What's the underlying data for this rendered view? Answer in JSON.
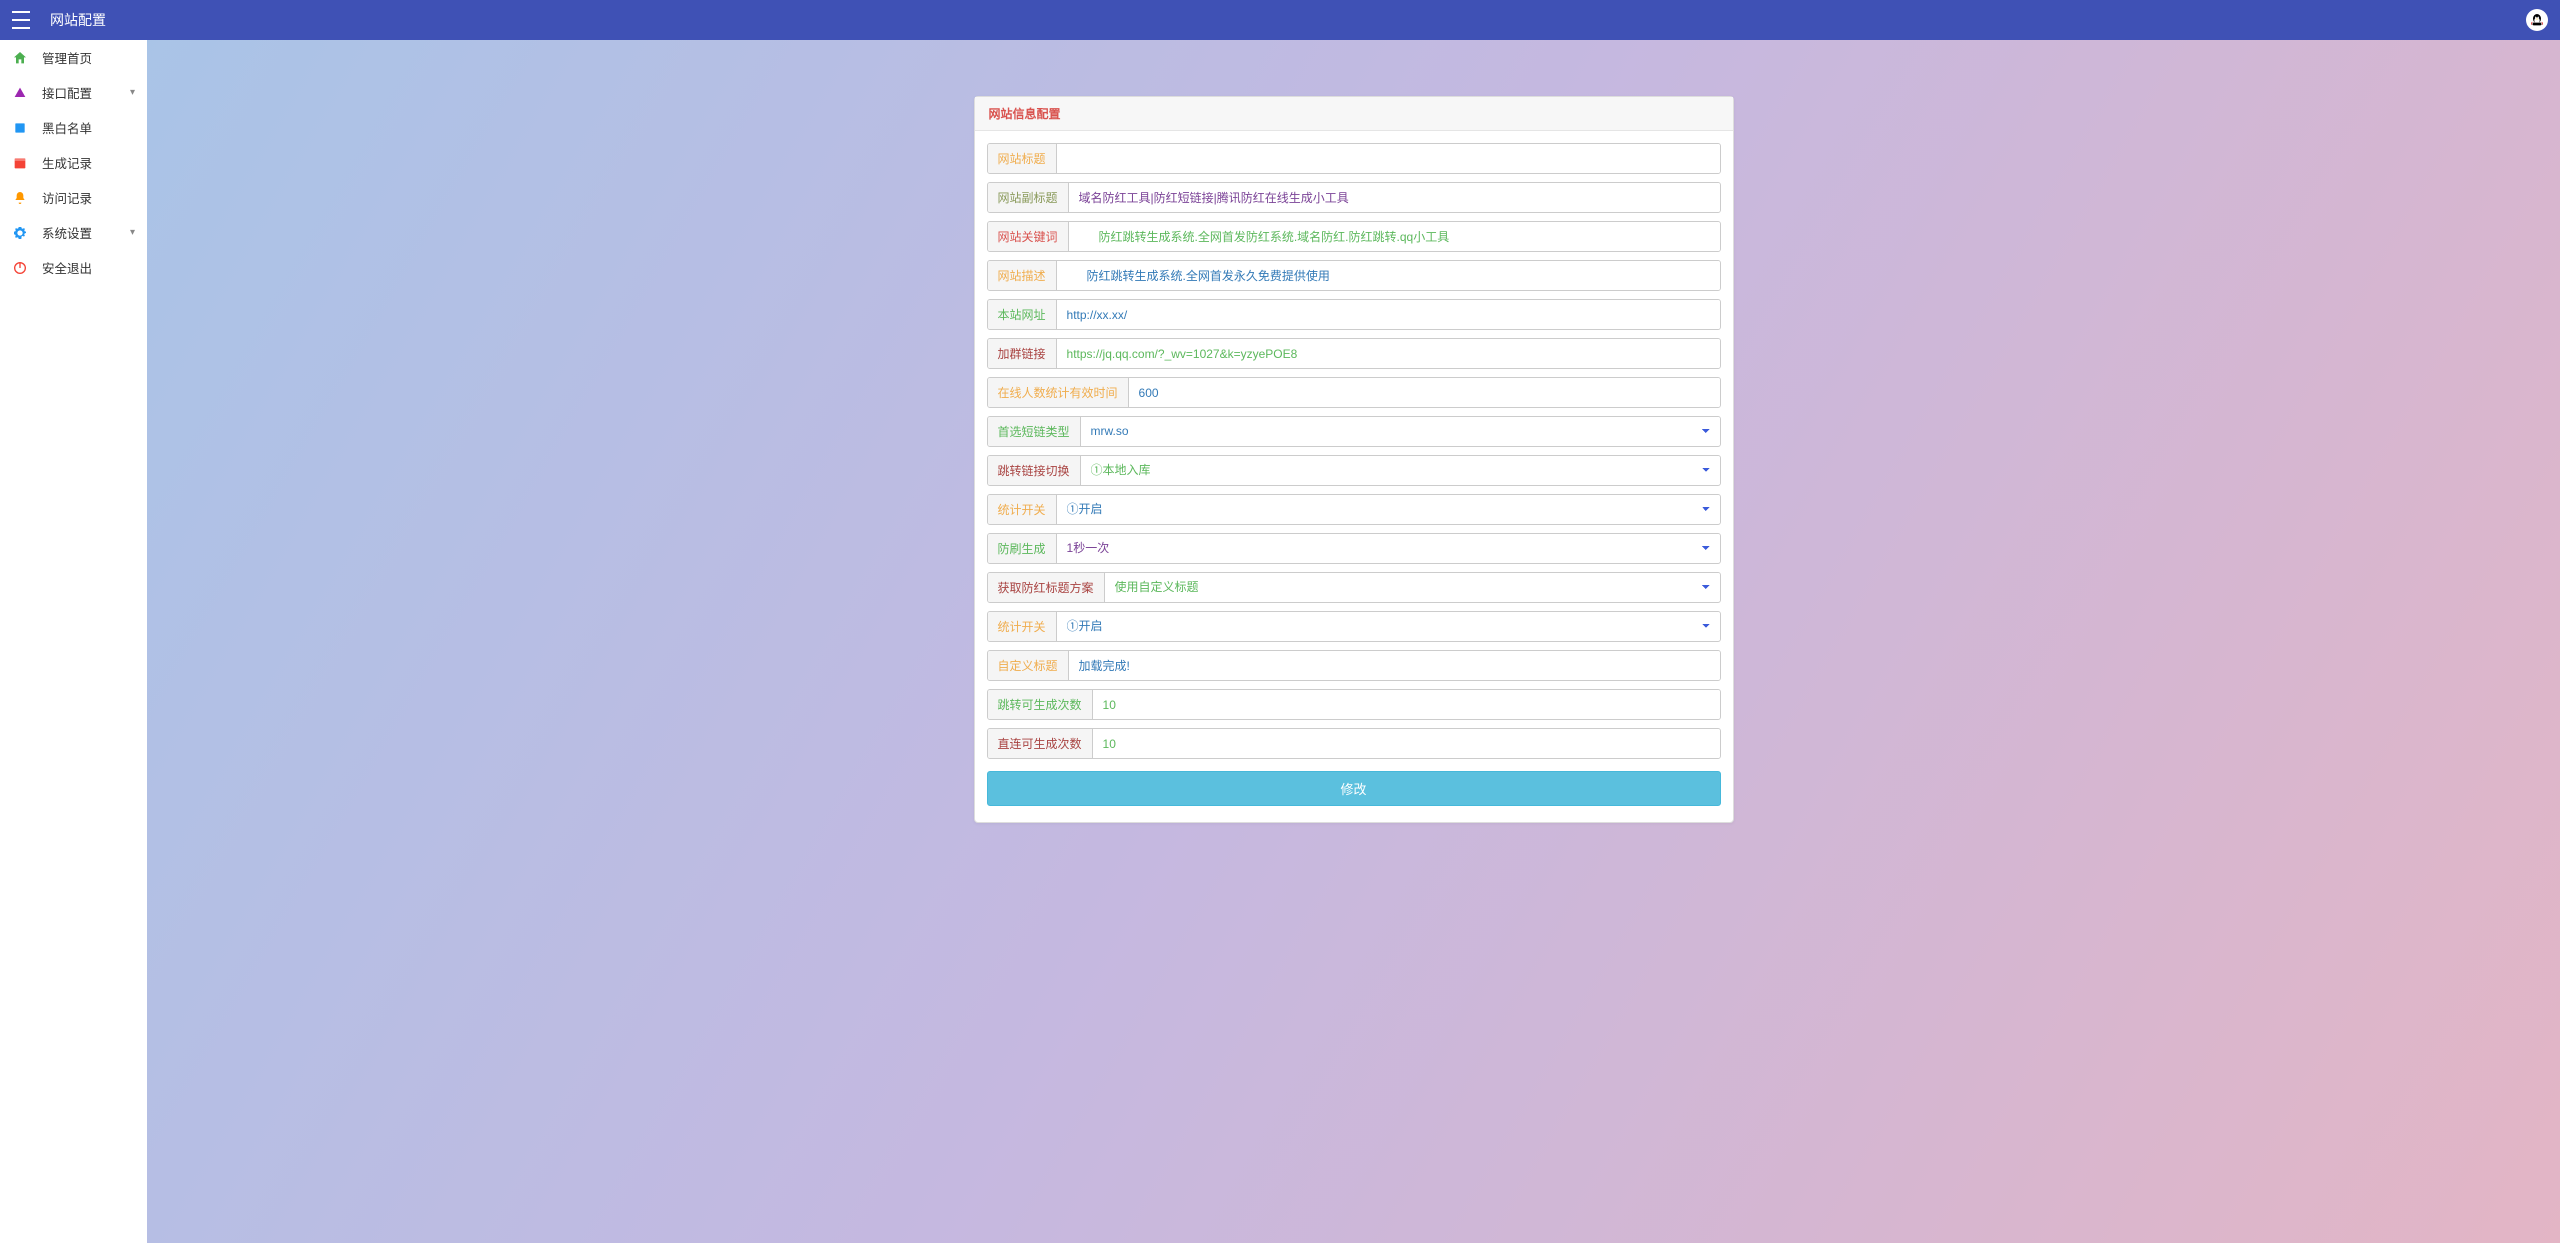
{
  "header": {
    "title": "网站配置"
  },
  "sidebar": {
    "items": [
      {
        "label": "管理首页",
        "icon": "home",
        "color": "#4caf50",
        "expandable": false
      },
      {
        "label": "接口配置",
        "icon": "triangle",
        "color": "#9c27b0",
        "expandable": true
      },
      {
        "label": "黑白名单",
        "icon": "tag",
        "color": "#2196f3",
        "expandable": false
      },
      {
        "label": "生成记录",
        "icon": "calendar",
        "color": "#f44336",
        "expandable": false
      },
      {
        "label": "访问记录",
        "icon": "bell",
        "color": "#ff9800",
        "expandable": false
      },
      {
        "label": "系统设置",
        "icon": "gear",
        "color": "#2196f3",
        "expandable": true
      },
      {
        "label": "安全退出",
        "icon": "power",
        "color": "#f44336",
        "expandable": false
      }
    ]
  },
  "panel": {
    "heading": "网站信息配置",
    "fields": {
      "site_title": {
        "label": "网站标题",
        "value": "",
        "label_color": "c-orange",
        "text_color": ""
      },
      "site_subtitle": {
        "label": "网站副标题",
        "value": "域名防红工具|防红短链接|腾讯防红在线生成小工具",
        "label_color": "c-olive",
        "text_color": "t-purple"
      },
      "site_keywords": {
        "label": "网站关键词",
        "value": "防红跳转生成系统.全网首发防红系统.域名防红.防红跳转.qq小工具",
        "label_color": "c-red",
        "text_color": "t-green"
      },
      "site_desc": {
        "label": "网站描述",
        "value": "防红跳转生成系统.全网首发永久免费提供使用",
        "label_color": "c-orange",
        "text_color": "t-blue"
      },
      "site_url": {
        "label": "本站网址",
        "value": "http://xx.xx/",
        "label_color": "c-green",
        "text_color": "t-blue"
      },
      "group_link": {
        "label": "加群链接",
        "value": "https://jq.qq.com/?_wv=1027&k=yzyePOE8",
        "label_color": "c-brown",
        "text_color": "t-green"
      },
      "online_stat_ttl": {
        "label": "在线人数统计有效时间",
        "value": "600",
        "label_color": "c-orange",
        "text_color": "t-blue"
      },
      "short_link_pref": {
        "label": "首选短链类型",
        "value": "mrw.so",
        "label_color": "c-green",
        "text_color": "t-blue"
      },
      "redirect_switch": {
        "label": "跳转链接切换",
        "value": "①本地入库",
        "label_color": "c-brown",
        "text_color": "t-green"
      },
      "stat_switch1": {
        "label": "统计开关",
        "value": "①开启",
        "label_color": "c-orange",
        "text_color": "t-blue"
      },
      "anti_brush": {
        "label": "防刷生成",
        "value": "1秒一次",
        "label_color": "c-green",
        "text_color": "t-purple"
      },
      "title_scheme": {
        "label": "获取防红标题方案",
        "value": "使用自定义标题",
        "label_color": "c-brown",
        "text_color": "t-green"
      },
      "stat_switch2": {
        "label": "统计开关",
        "value": "①开启",
        "label_color": "c-orange",
        "text_color": "t-blue"
      },
      "custom_title": {
        "label": "自定义标题",
        "value": "加载完成!",
        "label_color": "c-orange",
        "text_color": "t-blue"
      },
      "redirect_gen_cnt": {
        "label": "跳转可生成次数",
        "value": "10",
        "label_color": "c-green",
        "text_color": "t-green"
      },
      "direct_gen_cnt": {
        "label": "直连可生成次数",
        "value": "10",
        "label_color": "c-brown",
        "text_color": "t-green"
      }
    },
    "submit_label": "修改"
  }
}
